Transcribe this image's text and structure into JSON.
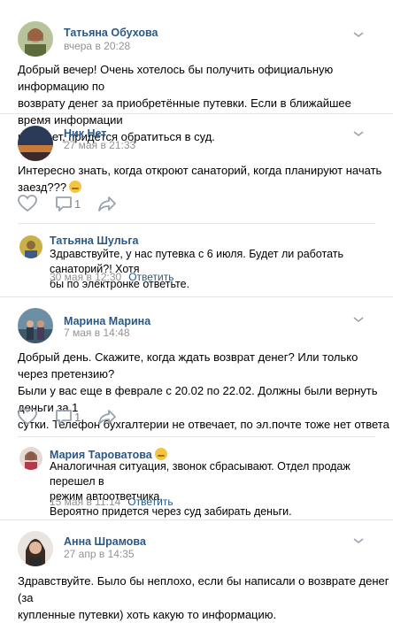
{
  "posts": [
    {
      "name": "Татьяна Обухова",
      "time": "вчера в 20:28",
      "lines": [
        "Добрый вечер! Очень хотелось бы получить официальную информацию по",
        "возврату денег за приобретённые путевки. Если в ближайшее время информации",
        "не будет, придётся обратиться в суд."
      ]
    },
    {
      "name": "Ник Нет",
      "time": "27 мая в 21:33",
      "lines": [
        "Интересно знать, когда откроют санаторий, когда планируют начать заезд???"
      ],
      "comments_count": "1",
      "reply": {
        "name": "Татьяна Шульга",
        "lines": [
          "Здравствуйте, у нас путевка с 6 июля. Будет ли работать санаторий?! Хотя",
          "бы по электронке ответьте."
        ],
        "time": "30 мая в 12:30",
        "answer": "Ответить"
      }
    },
    {
      "name": "Марина Марина",
      "time": "7 мая в 14:48",
      "lines": [
        "Добрый день. Скажите, когда ждать возврат денег? Или только через претензию?",
        "Были у вас еще в феврале с 20.02 по 22.02. Должны были вернуть деньги за 1",
        "сутки. Телефон бухгалтерии не отвечает, по эл.почте тоже нет ответа"
      ],
      "comments_count": "1",
      "reply": {
        "name": "Мария Тароватова",
        "lines": [
          "Аналогичная ситуация, звонок сбрасывают. Отдел продаж перешел в",
          "режим автоответчика.",
          "Вероятно придется через суд забирать деньги."
        ],
        "time": "15 мая в 11:14",
        "answer": "Ответить"
      }
    },
    {
      "name": "Анна Шрамова",
      "time": "27 апр в 14:35",
      "lines": [
        "Здравствуйте. Было бы неплохо, если бы написали о возврате денег (за",
        "купленные путевки) хоть какую то информацию."
      ]
    }
  ],
  "colors": {
    "link": "#2a5885",
    "meta": "#939393",
    "divider": "#e4e6ea",
    "icon": "#99a2ad"
  },
  "icons": [
    "chevron-down-icon",
    "heart-icon",
    "comment-icon",
    "share-icon",
    "emoji-icon"
  ]
}
